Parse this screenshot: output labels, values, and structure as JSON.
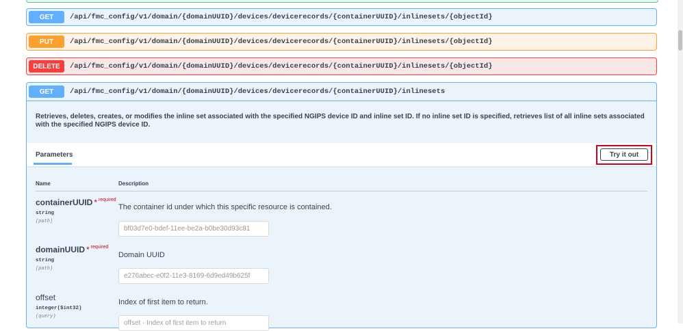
{
  "endpoints": [
    {
      "method": "GET",
      "path": "/api/fmc_config/v1/domain/{domainUUID}/devices/devicerecords/{containerUUID}/inlinesets/{objectId}"
    },
    {
      "method": "PUT",
      "path": "/api/fmc_config/v1/domain/{domainUUID}/devices/devicerecords/{containerUUID}/inlinesets/{objectId}"
    },
    {
      "method": "DELETE",
      "path": "/api/fmc_config/v1/domain/{domainUUID}/devices/devicerecords/{containerUUID}/inlinesets/{objectId}"
    }
  ],
  "expanded": {
    "method": "GET",
    "path": "/api/fmc_config/v1/domain/{domainUUID}/devices/devicerecords/{containerUUID}/inlinesets",
    "description": "Retrieves, deletes, creates, or modifies the inline set associated with the specified NGIPS device ID and inline set ID. If no inline set ID is specified, retrieves list of all inline sets associated with the specified NGIPS device ID.",
    "parameters_title": "Parameters",
    "try_it_out_label": "Try it out",
    "columns": {
      "name": "Name",
      "description": "Description"
    },
    "params": [
      {
        "name": "containerUUID",
        "star": "*",
        "required": "required",
        "type": "string",
        "in": "(path)",
        "description": "The container id under which this specific resource is contained.",
        "value": "bf03d7e0-bdef-11ee-be2a-b0be30d93c81",
        "placeholder": ""
      },
      {
        "name": "domainUUID",
        "star": "*",
        "required": "required",
        "type": "string",
        "in": "(path)",
        "description": "Domain UUID",
        "value": "e276abec-e0f2-11e3-8169-6d9ed49b625f",
        "placeholder": ""
      },
      {
        "name": "offset",
        "star": "",
        "required": "",
        "type": "integer($int32)",
        "in": "(query)",
        "description": "Index of first item to return.",
        "value": "",
        "placeholder": "offset - Index of first item to return"
      }
    ]
  },
  "colors": {
    "get": "#61affe",
    "put": "#fca130",
    "delete": "#f93e3e",
    "highlight": "#d0021b"
  }
}
